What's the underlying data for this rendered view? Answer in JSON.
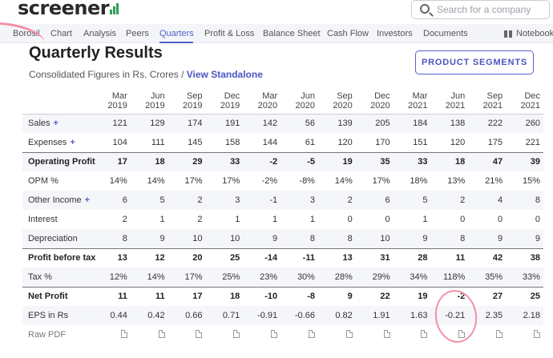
{
  "header": {
    "logo_text": "screener",
    "search_placeholder": "Search for a company"
  },
  "nav": {
    "items": [
      "Borosil",
      "Chart",
      "Analysis",
      "Peers",
      "Quarters",
      "Profit & Loss",
      "Balance Sheet",
      "Cash Flow",
      "Investors",
      "Documents"
    ],
    "active": "Quarters",
    "notebook": "Notebook"
  },
  "section": {
    "title": "Quarterly Results",
    "subtitle": "Consolidated Figures in Rs. Crores / ",
    "view_link": "View Standalone",
    "segments_button": "PRODUCT SEGMENTS"
  },
  "table": {
    "columns": [
      [
        "Mar",
        "2019"
      ],
      [
        "Jun",
        "2019"
      ],
      [
        "Sep",
        "2019"
      ],
      [
        "Dec",
        "2019"
      ],
      [
        "Mar",
        "2020"
      ],
      [
        "Jun",
        "2020"
      ],
      [
        "Sep",
        "2020"
      ],
      [
        "Dec",
        "2020"
      ],
      [
        "Mar",
        "2021"
      ],
      [
        "Jun",
        "2021"
      ],
      [
        "Sep",
        "2021"
      ],
      [
        "Dec",
        "2021"
      ]
    ],
    "rows": [
      {
        "label": "Sales",
        "plus": true,
        "bold": false,
        "values": [
          "121",
          "129",
          "174",
          "191",
          "142",
          "56",
          "139",
          "205",
          "184",
          "138",
          "222",
          "260"
        ]
      },
      {
        "label": "Expenses",
        "plus": true,
        "bold": false,
        "values": [
          "104",
          "111",
          "145",
          "158",
          "144",
          "61",
          "120",
          "170",
          "151",
          "120",
          "175",
          "221"
        ]
      },
      {
        "label": "Operating Profit",
        "plus": false,
        "bold": true,
        "values": [
          "17",
          "18",
          "29",
          "33",
          "-2",
          "-5",
          "19",
          "35",
          "33",
          "18",
          "47",
          "39"
        ]
      },
      {
        "label": "OPM %",
        "plus": false,
        "bold": false,
        "values": [
          "14%",
          "14%",
          "17%",
          "17%",
          "-2%",
          "-8%",
          "14%",
          "17%",
          "18%",
          "13%",
          "21%",
          "15%"
        ]
      },
      {
        "label": "Other Income",
        "plus": true,
        "bold": false,
        "values": [
          "6",
          "5",
          "2",
          "3",
          "-1",
          "3",
          "2",
          "6",
          "5",
          "2",
          "4",
          "8"
        ]
      },
      {
        "label": "Interest",
        "plus": false,
        "bold": false,
        "values": [
          "2",
          "1",
          "2",
          "1",
          "1",
          "1",
          "0",
          "0",
          "1",
          "0",
          "0",
          "0"
        ]
      },
      {
        "label": "Depreciation",
        "plus": false,
        "bold": false,
        "values": [
          "8",
          "9",
          "10",
          "10",
          "9",
          "8",
          "8",
          "10",
          "9",
          "8",
          "9",
          "9"
        ]
      },
      {
        "label": "Profit before tax",
        "plus": false,
        "bold": true,
        "values": [
          "13",
          "12",
          "20",
          "25",
          "-14",
          "-11",
          "13",
          "31",
          "28",
          "11",
          "42",
          "38"
        ]
      },
      {
        "label": "Tax %",
        "plus": false,
        "bold": false,
        "values": [
          "12%",
          "14%",
          "17%",
          "25%",
          "23%",
          "30%",
          "28%",
          "29%",
          "34%",
          "118%",
          "35%",
          "33%"
        ]
      },
      {
        "label": "Net Profit",
        "plus": false,
        "bold": true,
        "values": [
          "11",
          "11",
          "17",
          "18",
          "-10",
          "-8",
          "9",
          "22",
          "19",
          "-2",
          "27",
          "25"
        ]
      },
      {
        "label": "EPS in Rs",
        "plus": false,
        "bold": false,
        "values": [
          "0.44",
          "0.42",
          "0.66",
          "0.71",
          "-0.91",
          "-0.66",
          "0.82",
          "1.91",
          "1.63",
          "-0.21",
          "2.35",
          "2.18"
        ]
      }
    ],
    "raw_pdf_label": "Raw PDF"
  },
  "colors": {
    "accent": "#5560c8",
    "annotation": "#f48fa6",
    "logo_green": "#2f9e5a"
  }
}
